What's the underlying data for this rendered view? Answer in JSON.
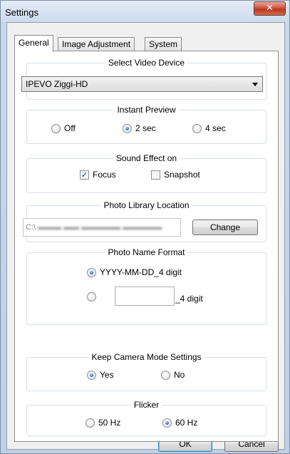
{
  "window": {
    "title": "Settings",
    "close_glyph": "✕"
  },
  "tabs": [
    {
      "label": "General",
      "active": true
    },
    {
      "label": "Image Adjustment",
      "active": false
    },
    {
      "label": "System",
      "active": false
    }
  ],
  "video_device": {
    "title": "Select Video Device",
    "selected": "IPEVO Ziggi-HD"
  },
  "instant_preview": {
    "title": "Instant Preview",
    "options": [
      {
        "label": "Off",
        "selected": false
      },
      {
        "label": "2 sec",
        "selected": true
      },
      {
        "label": "4 sec",
        "selected": false
      }
    ]
  },
  "sound_effect": {
    "title": "Sound Effect on",
    "options": [
      {
        "label": "Focus",
        "checked": true
      },
      {
        "label": "Snapshot",
        "checked": false
      }
    ]
  },
  "photo_library": {
    "title": "Photo Library Location",
    "path_visible_prefix": "C:\\",
    "change_label": "Change"
  },
  "photo_name": {
    "title": "Photo Name Format",
    "option1_label": "YYYY-MM-DD_4 digit",
    "option1_selected": true,
    "option2_suffix": "_4 digit",
    "option2_selected": false,
    "custom_value": ""
  },
  "camera_mode": {
    "title": "Keep Camera Mode Settings",
    "options": [
      {
        "label": "Yes",
        "selected": true
      },
      {
        "label": "No",
        "selected": false
      }
    ]
  },
  "flicker": {
    "title": "Flicker",
    "options": [
      {
        "label": "50 Hz",
        "selected": false
      },
      {
        "label": "60 Hz",
        "selected": true
      }
    ]
  },
  "footer": {
    "ok_label": "OK",
    "cancel_label": "Cancel"
  }
}
